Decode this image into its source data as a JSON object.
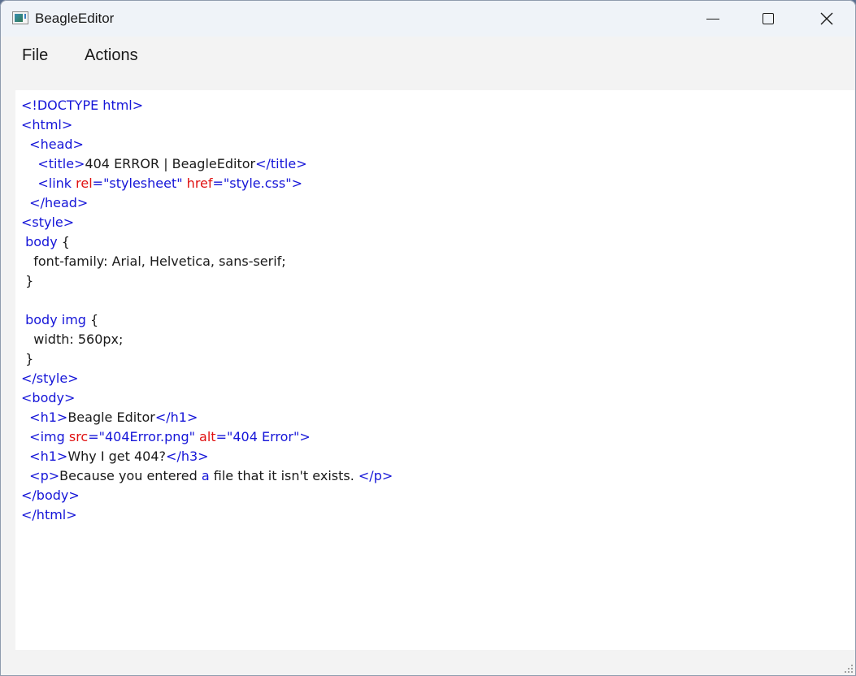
{
  "window": {
    "title": "BeagleEditor",
    "controls": {
      "minimize": "minimize",
      "maximize": "maximize",
      "close": "close"
    }
  },
  "menubar": {
    "items": [
      {
        "label": "File"
      },
      {
        "label": "Actions"
      }
    ]
  },
  "colors": {
    "tag": "#1515d8",
    "attribute": "#e01010",
    "string": "#1515d8",
    "text": "#1a1a1a",
    "editor_bg": "#ffffff",
    "chrome_bg": "#f3f3f3"
  },
  "editor": {
    "lines": [
      [
        {
          "k": "t",
          "v": "<!DOCTYPE html>"
        }
      ],
      [
        {
          "k": "t",
          "v": "<html>"
        }
      ],
      [
        {
          "k": "p",
          "v": "  "
        },
        {
          "k": "t",
          "v": "<head>"
        }
      ],
      [
        {
          "k": "p",
          "v": "    "
        },
        {
          "k": "t",
          "v": "<title>"
        },
        {
          "k": "p",
          "v": "404 ERROR | BeagleEditor"
        },
        {
          "k": "t",
          "v": "</title>"
        }
      ],
      [
        {
          "k": "p",
          "v": "    "
        },
        {
          "k": "t",
          "v": "<link "
        },
        {
          "k": "a",
          "v": "rel"
        },
        {
          "k": "t",
          "v": "=\"stylesheet\" "
        },
        {
          "k": "a",
          "v": "href"
        },
        {
          "k": "t",
          "v": "=\"style.css\">"
        }
      ],
      [
        {
          "k": "p",
          "v": "  "
        },
        {
          "k": "t",
          "v": "</head>"
        }
      ],
      [
        {
          "k": "t",
          "v": "<style>"
        }
      ],
      [
        {
          "k": "p",
          "v": " "
        },
        {
          "k": "t",
          "v": "body"
        },
        {
          "k": "p",
          "v": " {"
        }
      ],
      [
        {
          "k": "p",
          "v": "   font-family: Arial, Helvetica, sans-serif;"
        }
      ],
      [
        {
          "k": "p",
          "v": " }"
        }
      ],
      [
        {
          "k": "p",
          "v": ""
        }
      ],
      [
        {
          "k": "p",
          "v": " "
        },
        {
          "k": "t",
          "v": "body img"
        },
        {
          "k": "p",
          "v": " {"
        }
      ],
      [
        {
          "k": "p",
          "v": "   width: 560px;"
        }
      ],
      [
        {
          "k": "p",
          "v": " }"
        }
      ],
      [
        {
          "k": "t",
          "v": "</style>"
        }
      ],
      [
        {
          "k": "t",
          "v": "<body>"
        }
      ],
      [
        {
          "k": "p",
          "v": "  "
        },
        {
          "k": "t",
          "v": "<h1>"
        },
        {
          "k": "p",
          "v": "Beagle Editor"
        },
        {
          "k": "t",
          "v": "</h1>"
        }
      ],
      [
        {
          "k": "p",
          "v": "  "
        },
        {
          "k": "t",
          "v": "<img "
        },
        {
          "k": "a",
          "v": "src"
        },
        {
          "k": "t",
          "v": "=\"404Error.png\" "
        },
        {
          "k": "a",
          "v": "alt"
        },
        {
          "k": "t",
          "v": "=\"404 Error\">"
        }
      ],
      [
        {
          "k": "p",
          "v": "  "
        },
        {
          "k": "t",
          "v": "<h1>"
        },
        {
          "k": "p",
          "v": "Why I get 404?"
        },
        {
          "k": "t",
          "v": "</h3>"
        }
      ],
      [
        {
          "k": "p",
          "v": "  "
        },
        {
          "k": "t",
          "v": "<p>"
        },
        {
          "k": "p",
          "v": "Because you entered "
        },
        {
          "k": "t",
          "v": "a"
        },
        {
          "k": "p",
          "v": " file that it isn't exists. "
        },
        {
          "k": "t",
          "v": "</p>"
        }
      ],
      [
        {
          "k": "t",
          "v": "</body>"
        }
      ],
      [
        {
          "k": "t",
          "v": "</html>"
        }
      ]
    ]
  }
}
